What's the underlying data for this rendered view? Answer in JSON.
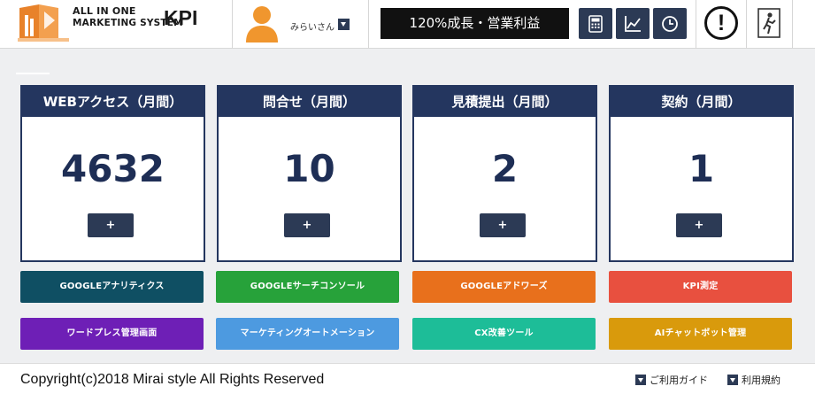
{
  "header": {
    "logo_line1": "ALL IN ONE",
    "logo_line2": "MARKETING SYSTEM",
    "logo_kpi": "KPI",
    "user_name": "みらいさん",
    "goal_text": "120%成長・営業利益",
    "tools": [
      {
        "icon": "calculator-icon"
      },
      {
        "icon": "line-chart-icon"
      },
      {
        "icon": "clock-icon"
      }
    ],
    "alert_glyph": "!",
    "exit_icon": "exit-door-icon"
  },
  "cards": [
    {
      "title": "WEBアクセス（月間）",
      "value": "4632",
      "add_label": "+"
    },
    {
      "title": "問合せ（月間）",
      "value": "10",
      "add_label": "+"
    },
    {
      "title": "見積提出（月間）",
      "value": "2",
      "add_label": "+"
    },
    {
      "title": "契約（月間）",
      "value": "1",
      "add_label": "+"
    }
  ],
  "services_row1": [
    {
      "label": "GOOGLEアナリティクス",
      "color": "#0f4f63"
    },
    {
      "label": "GOOGLEサーチコンソール",
      "color": "#27a23a"
    },
    {
      "label": "GOOGLEアドワーズ",
      "color": "#e8701c"
    },
    {
      "label": "KPI測定",
      "color": "#e8503f"
    }
  ],
  "services_row2": [
    {
      "label": "ワードプレス管理画面",
      "color": "#6e1fb6"
    },
    {
      "label": "マーケティングオートメーション",
      "color": "#4d9ae0"
    },
    {
      "label": "CX改善ツール",
      "color": "#1dbd98"
    },
    {
      "label": "AIチャットボット管理",
      "color": "#d99a0c"
    }
  ],
  "footer": {
    "copyright": "Copyright(c)2018 Mirai style All Rights Reserved",
    "guide_label": "ご利用ガイド",
    "terms_label": "利用規約"
  },
  "colors": {
    "navy": "#24365f",
    "tool_bg": "#2c3a55",
    "logo_orange": "#e8822a"
  }
}
